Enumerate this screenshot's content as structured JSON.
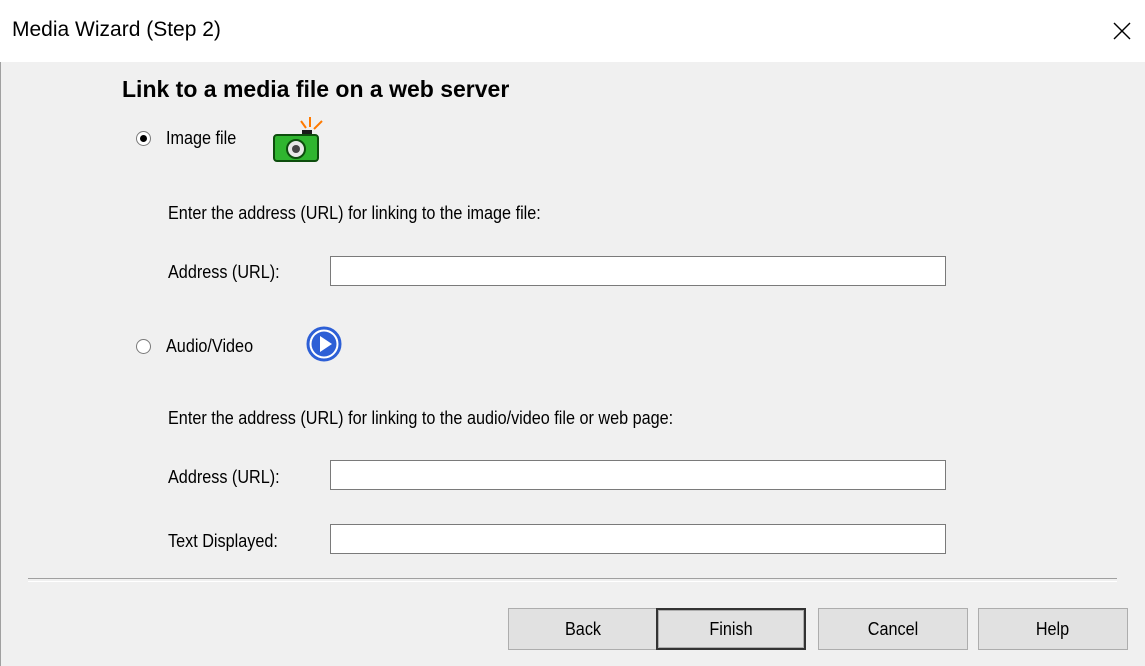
{
  "window": {
    "title": "Media Wizard (Step 2)"
  },
  "heading": "Link to a media file on a web server",
  "image_option": {
    "label": "Image file",
    "selected": true,
    "icon": "camera-icon",
    "instruction": "Enter the address (URL) for linking to the image file:",
    "address_label": "Address (URL):",
    "address_value": ""
  },
  "av_option": {
    "label": "Audio/Video",
    "selected": false,
    "icon": "play-icon",
    "instruction": "Enter the address (URL) for linking to the audio/video file or web page:",
    "address_label": "Address (URL):",
    "address_value": "",
    "text_label": "Text Displayed:",
    "text_value": ""
  },
  "buttons": {
    "back": "Back",
    "finish": "Finish",
    "cancel": "Cancel",
    "help": "Help"
  },
  "colors": {
    "camera_body": "#2fb52f",
    "camera_flash": "#ff7a00",
    "play_circle": "#2d5fd6"
  }
}
